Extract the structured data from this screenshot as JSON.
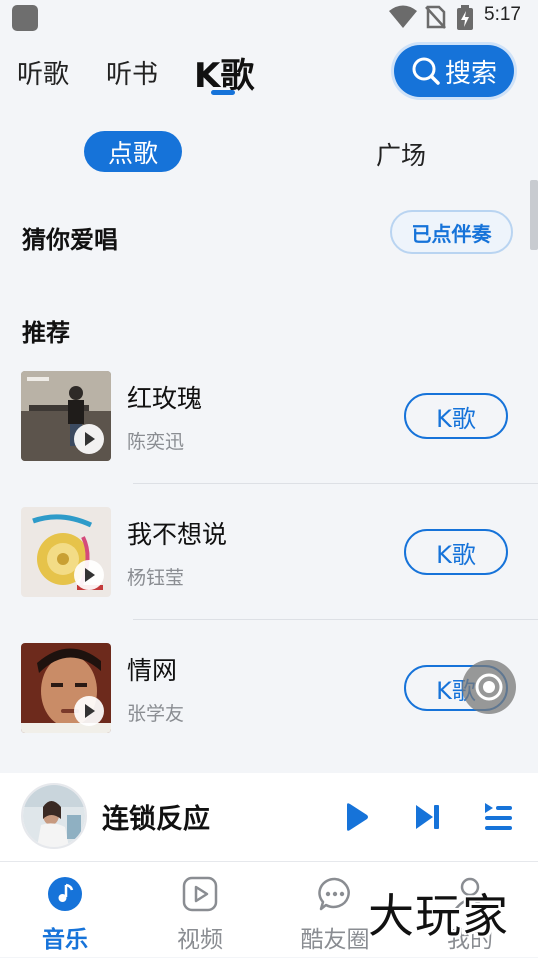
{
  "status_bar": {
    "time": "5:17"
  },
  "top_nav": {
    "tabs": [
      {
        "label": "听歌"
      },
      {
        "label": "听书"
      },
      {
        "label": "K歌"
      }
    ],
    "active_tab": "K歌",
    "search_label": "搜索"
  },
  "sub_tabs": {
    "items": [
      "点歌",
      "广场"
    ],
    "active": "点歌"
  },
  "guess": {
    "title": "猜你爱唱",
    "accompaniment_button": "已点伴奏"
  },
  "recommend": {
    "title": "推荐",
    "songs": [
      {
        "title": "红玫瑰",
        "artist": "陈奕迅",
        "button": "K歌"
      },
      {
        "title": "我不想说",
        "artist": "杨钰莹",
        "button": "K歌"
      },
      {
        "title": "情网",
        "artist": "张学友",
        "button": "K歌"
      }
    ]
  },
  "player": {
    "now_playing": "连锁反应"
  },
  "bottom_nav": {
    "items": [
      {
        "label": "音乐",
        "icon": "music-note-icon",
        "active": true
      },
      {
        "label": "视频",
        "icon": "video-play-icon",
        "active": false
      },
      {
        "label": "酷友圈",
        "icon": "chat-bubble-icon",
        "active": false
      },
      {
        "label": "我的",
        "icon": "profile-icon",
        "active": false
      }
    ]
  },
  "watermark": "大玩家",
  "colors": {
    "accent": "#1673d9",
    "background": "#f3f5f8",
    "secondary_text": "#8a8d92"
  }
}
